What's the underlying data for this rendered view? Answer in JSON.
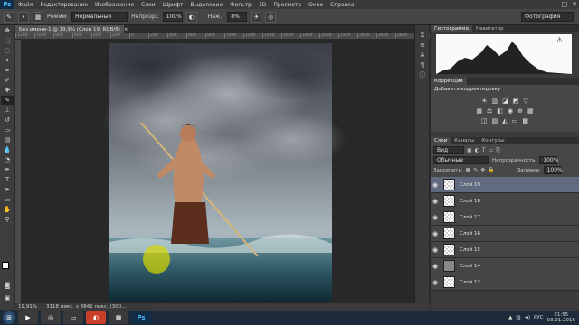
{
  "menubar": {
    "logo": "Ps",
    "items": [
      "Файл",
      "Редактирование",
      "Изображение",
      "Слои",
      "Шрифт",
      "Выделение",
      "Фильтр",
      "3D",
      "Просмотр",
      "Окно",
      "Справка"
    ],
    "window_controls": [
      "–",
      "□",
      "✕"
    ]
  },
  "options": {
    "mode_label": "Режим:",
    "mode_value": "Нормальный",
    "opacity_label": "Непрозр.:",
    "opacity_value": "100%",
    "flow_label": "Наж.:",
    "flow_value": "8%",
    "workspace": "Фотография"
  },
  "document": {
    "tab_title": "Без имени-1 @ 19,9% (Слой 19, RGB/8)",
    "tab_close": "×",
    "ruler_ticks": [
      "1200",
      "1000",
      "800",
      "600",
      "400",
      "200",
      "0",
      "200",
      "400",
      "600",
      "800",
      "1000",
      "1200",
      "1400",
      "1600",
      "1800",
      "2000",
      "2200",
      "2400",
      "2600",
      "2800",
      "3000"
    ],
    "zoom": "19,91%",
    "doc_info": "3118 пикс. x 3841 пикс. (300..."
  },
  "histogram": {
    "tabs": [
      "Гистограмма",
      "Навигатор"
    ],
    "warning_icon": "warning-icon"
  },
  "adjustments": {
    "tab": "Коррекция",
    "title": "Добавить корректировку"
  },
  "layers": {
    "tabs": [
      "Слои",
      "Каналы",
      "Контуры"
    ],
    "filter_value": "Вид",
    "blend_mode": "Обычные",
    "opacity_label": "Непрозрачность:",
    "opacity_value": "100%",
    "lock_label": "Закрепить:",
    "fill_label": "Заливка:",
    "fill_value": "100%",
    "items": [
      {
        "name": "Слой 19",
        "selected": true,
        "gray": false
      },
      {
        "name": "Слой 18",
        "selected": false,
        "gray": false
      },
      {
        "name": "Слой 17",
        "selected": false,
        "gray": false
      },
      {
        "name": "Слой 16",
        "selected": false,
        "gray": false
      },
      {
        "name": "Слой 15",
        "selected": false,
        "gray": false
      },
      {
        "name": "Слой 14",
        "selected": false,
        "gray": true
      },
      {
        "name": "Слой 12",
        "selected": false,
        "gray": false
      }
    ]
  },
  "taskbar": {
    "apps": [
      "windows-start-icon",
      "media-player-icon",
      "chrome-icon",
      "folder-icon",
      "app-icon",
      "app-icon",
      "photoshop-icon"
    ],
    "ps_label": "Ps",
    "lang": "РУС",
    "time": "21:55",
    "date": "03.01.2016"
  },
  "colors": {
    "accent": "#4fb6ff",
    "selected_layer": "#616b80"
  }
}
